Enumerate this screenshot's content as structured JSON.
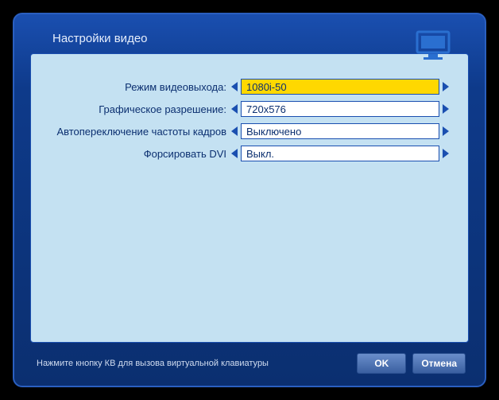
{
  "title": "Настройки видео",
  "icon": "monitor-icon",
  "settings": [
    {
      "label": "Режим видеовыхода:",
      "value": "1080i-50",
      "selected": true
    },
    {
      "label": "Графическое разрешение:",
      "value": "720x576",
      "selected": false
    },
    {
      "label": "Автопереключение частоты кадров",
      "value": "Выключено",
      "selected": false
    },
    {
      "label": "Форсировать DVI",
      "value": "Выкл.",
      "selected": false
    }
  ],
  "footer": {
    "hint": "Нажмите кнопку КВ для вызова виртуальной клавиатуры",
    "ok": "OK",
    "cancel": "Отмена"
  },
  "colors": {
    "arrow": "#1a4fb0"
  }
}
